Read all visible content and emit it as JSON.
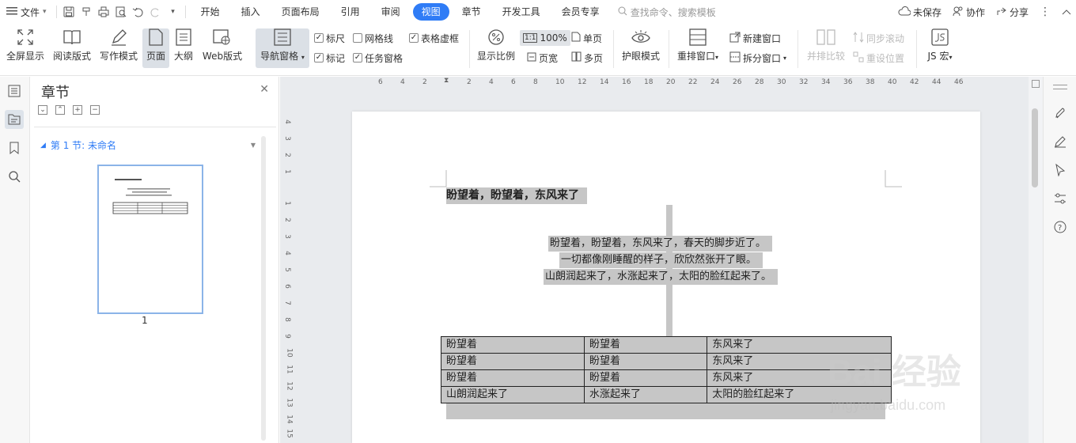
{
  "menubar": {
    "file_label": "文件",
    "menus": [
      "开始",
      "插入",
      "页面布局",
      "引用",
      "审阅",
      "视图",
      "章节",
      "开发工具",
      "会员专享"
    ],
    "active_menu": "视图",
    "search_placeholder": "查找命令、搜索模板",
    "unsaved_label": "未保存",
    "collab_label": "协作",
    "share_label": "分享"
  },
  "ribbon": {
    "fullscreen": "全屏显示",
    "reading": "阅读版式",
    "writing": "写作模式",
    "page": "页面",
    "outline": "大纲",
    "web": "Web版式",
    "nav_pane": "导航窗格",
    "ruler": "标尺",
    "gridlines": "网格线",
    "table_gridlines": "表格虚框",
    "marks": "标记",
    "task_pane": "任务窗格",
    "zoom": "显示比例",
    "zoom100": "100%",
    "page_width": "页宽",
    "single_page": "单页",
    "multi_page": "多页",
    "eye_mode": "护眼模式",
    "rearrange": "重排窗口",
    "new_window": "新建窗口",
    "split_window": "拆分窗口",
    "side_by_side": "并排比较",
    "sync_scroll": "同步滚动",
    "reset_pos": "重设位置",
    "macro": "JS 宏",
    "checks": {
      "ruler": true,
      "gridlines": false,
      "table_gridlines": true,
      "marks": true,
      "task_pane": true
    }
  },
  "navpane": {
    "title": "章节",
    "section": "第 1 节: 未命名",
    "page_number": "1"
  },
  "ruler": {
    "h_ticks": [
      "6",
      "4",
      "2",
      "2",
      "4",
      "6",
      "8",
      "10",
      "12",
      "14",
      "16",
      "18",
      "20",
      "22",
      "24",
      "26",
      "28",
      "30",
      "32",
      "34",
      "36",
      "38",
      "40",
      "42",
      "44",
      "46"
    ],
    "v_ticks": [
      "4",
      "3",
      "2",
      "1",
      "1",
      "2",
      "3",
      "4",
      "5",
      "6",
      "7",
      "8",
      "9",
      "10",
      "11",
      "12",
      "13",
      "14",
      "15"
    ]
  },
  "document": {
    "heading": "盼望着，盼望着，东风来了",
    "poem": [
      "盼望着，盼望着，东风来了，春天的脚步近了。",
      "一切都像刚睡醒的样子，欣欣然张开了眼。",
      "山朗润起来了，水涨起来了，太阳的脸红起来了。"
    ],
    "table": [
      [
        "盼望着",
        "盼望着",
        "东风来了"
      ],
      [
        "盼望着",
        "盼望着",
        "东风来了"
      ],
      [
        "盼望着",
        "盼望着",
        "东风来了"
      ],
      [
        "山朗润起来了",
        "水涨起来了",
        "太阳的脸红起来了"
      ]
    ]
  },
  "watermark": {
    "brand": "Bai 经验",
    "url": "jingyan.baidu.com"
  },
  "colors": {
    "accent": "#2f7cf6",
    "highlight": "#c6c6c6",
    "canvas": "#e9ebee"
  }
}
